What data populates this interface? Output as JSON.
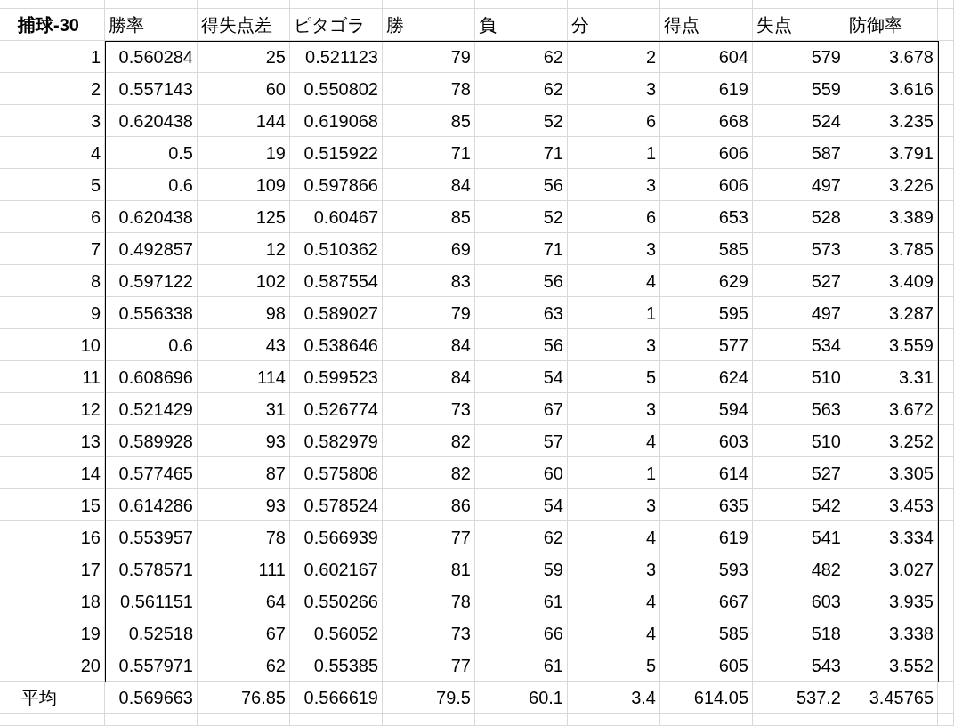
{
  "sheet": {
    "title": "捕球-30",
    "columns": [
      "勝率",
      "得失点差",
      "ピタゴラ",
      "勝",
      "負",
      "分",
      "得点",
      "失点",
      "防御率"
    ],
    "rows": [
      {
        "label": "1",
        "cells": [
          "0.560284",
          "25",
          "0.521123",
          "79",
          "62",
          "2",
          "604",
          "579",
          "3.678"
        ]
      },
      {
        "label": "2",
        "cells": [
          "0.557143",
          "60",
          "0.550802",
          "78",
          "62",
          "3",
          "619",
          "559",
          "3.616"
        ]
      },
      {
        "label": "3",
        "cells": [
          "0.620438",
          "144",
          "0.619068",
          "85",
          "52",
          "6",
          "668",
          "524",
          "3.235"
        ]
      },
      {
        "label": "4",
        "cells": [
          "0.5",
          "19",
          "0.515922",
          "71",
          "71",
          "1",
          "606",
          "587",
          "3.791"
        ]
      },
      {
        "label": "5",
        "cells": [
          "0.6",
          "109",
          "0.597866",
          "84",
          "56",
          "3",
          "606",
          "497",
          "3.226"
        ]
      },
      {
        "label": "6",
        "cells": [
          "0.620438",
          "125",
          "0.60467",
          "85",
          "52",
          "6",
          "653",
          "528",
          "3.389"
        ]
      },
      {
        "label": "7",
        "cells": [
          "0.492857",
          "12",
          "0.510362",
          "69",
          "71",
          "3",
          "585",
          "573",
          "3.785"
        ]
      },
      {
        "label": "8",
        "cells": [
          "0.597122",
          "102",
          "0.587554",
          "83",
          "56",
          "4",
          "629",
          "527",
          "3.409"
        ]
      },
      {
        "label": "9",
        "cells": [
          "0.556338",
          "98",
          "0.589027",
          "79",
          "63",
          "1",
          "595",
          "497",
          "3.287"
        ]
      },
      {
        "label": "10",
        "cells": [
          "0.6",
          "43",
          "0.538646",
          "84",
          "56",
          "3",
          "577",
          "534",
          "3.559"
        ]
      },
      {
        "label": "11",
        "cells": [
          "0.608696",
          "114",
          "0.599523",
          "84",
          "54",
          "5",
          "624",
          "510",
          "3.31"
        ]
      },
      {
        "label": "12",
        "cells": [
          "0.521429",
          "31",
          "0.526774",
          "73",
          "67",
          "3",
          "594",
          "563",
          "3.672"
        ]
      },
      {
        "label": "13",
        "cells": [
          "0.589928",
          "93",
          "0.582979",
          "82",
          "57",
          "4",
          "603",
          "510",
          "3.252"
        ]
      },
      {
        "label": "14",
        "cells": [
          "0.577465",
          "87",
          "0.575808",
          "82",
          "60",
          "1",
          "614",
          "527",
          "3.305"
        ]
      },
      {
        "label": "15",
        "cells": [
          "0.614286",
          "93",
          "0.578524",
          "86",
          "54",
          "3",
          "635",
          "542",
          "3.453"
        ]
      },
      {
        "label": "16",
        "cells": [
          "0.553957",
          "78",
          "0.566939",
          "77",
          "62",
          "4",
          "619",
          "541",
          "3.334"
        ]
      },
      {
        "label": "17",
        "cells": [
          "0.578571",
          "111",
          "0.602167",
          "81",
          "59",
          "3",
          "593",
          "482",
          "3.027"
        ]
      },
      {
        "label": "18",
        "cells": [
          "0.561151",
          "64",
          "0.550266",
          "78",
          "61",
          "4",
          "667",
          "603",
          "3.935"
        ]
      },
      {
        "label": "19",
        "cells": [
          "0.52518",
          "67",
          "0.56052",
          "73",
          "66",
          "4",
          "585",
          "518",
          "3.338"
        ]
      },
      {
        "label": "20",
        "cells": [
          "0.557971",
          "62",
          "0.55385",
          "77",
          "61",
          "5",
          "605",
          "543",
          "3.552"
        ]
      }
    ],
    "average": {
      "label": "平均",
      "cells": [
        "0.569663",
        "76.85",
        "0.566619",
        "79.5",
        "60.1",
        "3.4",
        "614.05",
        "537.2",
        "3.45765"
      ]
    }
  }
}
